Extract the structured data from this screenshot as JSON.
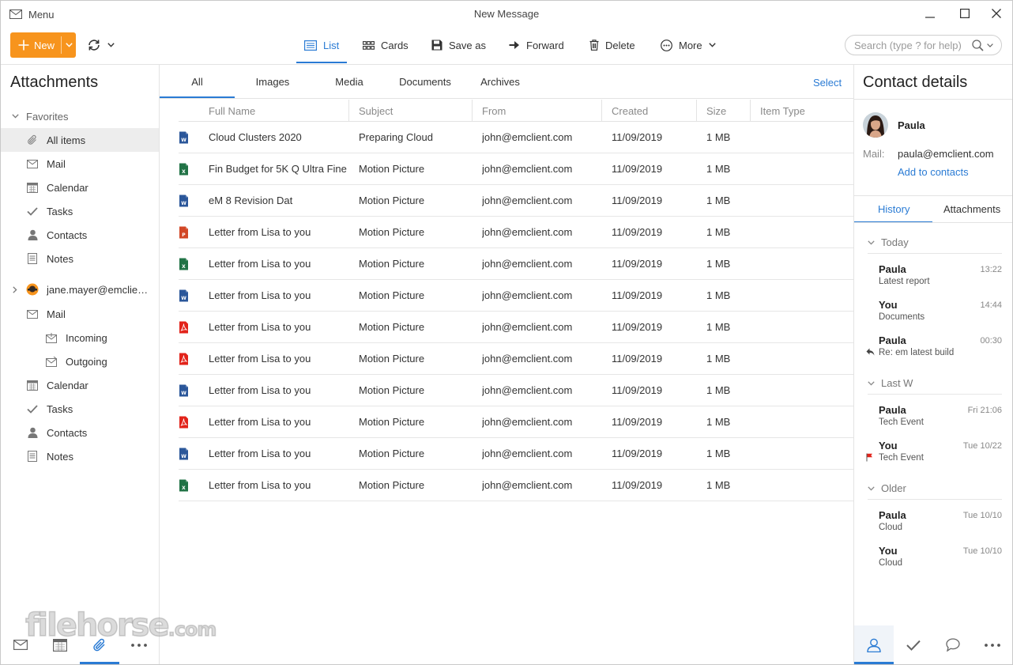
{
  "window": {
    "menu_label": "Menu",
    "title": "New Message"
  },
  "toolbar": {
    "new_label": "New",
    "items": [
      {
        "label": "List",
        "icon": "list-icon",
        "active": true
      },
      {
        "label": "Cards",
        "icon": "cards-icon",
        "active": false
      },
      {
        "label": "Save as",
        "icon": "floppy-disk-icon",
        "active": false
      },
      {
        "label": "Forward",
        "icon": "arrow-right-icon",
        "active": false
      },
      {
        "label": "Delete",
        "icon": "trash-icon",
        "active": false
      },
      {
        "label": "More",
        "icon": "more-circle-icon",
        "active": false
      }
    ],
    "search_placeholder": "Search (type ? for help)"
  },
  "sidebar": {
    "title": "Attachments",
    "favorites_label": "Favorites",
    "favorites": [
      {
        "label": "All items",
        "icon": "paperclip-icon",
        "selected": true
      },
      {
        "label": "Mail",
        "icon": "envelope-icon"
      },
      {
        "label": "Calendar",
        "icon": "calendar-icon"
      },
      {
        "label": "Tasks",
        "icon": "checkmark-icon"
      },
      {
        "label": "Contacts",
        "icon": "person-icon"
      },
      {
        "label": "Notes",
        "icon": "note-icon"
      }
    ],
    "account_label": "jane.mayer@emclient.com",
    "account_items": [
      {
        "label": "Mail",
        "icon": "envelope-icon",
        "level": 1
      },
      {
        "label": "Incoming",
        "icon": "inbox-icon",
        "level": 2
      },
      {
        "label": "Outgoing",
        "icon": "outbox-icon",
        "level": 2
      },
      {
        "label": "Calendar",
        "icon": "calendar-icon",
        "level": 1
      },
      {
        "label": "Tasks",
        "icon": "checkmark-icon",
        "level": 1
      },
      {
        "label": "Contacts",
        "icon": "person-icon",
        "level": 1
      },
      {
        "label": "Notes",
        "icon": "note-icon",
        "level": 1
      }
    ]
  },
  "bottom_nav_left": [
    "envelope-icon",
    "calendar-icon",
    "paperclip-icon",
    "more-dots-icon"
  ],
  "watermark": {
    "main": "filehorse",
    "suffix": ".com"
  },
  "main": {
    "tabs": [
      "All",
      "Images",
      "Media",
      "Documents",
      "Archives"
    ],
    "active_tab": "All",
    "select_label": "Select",
    "columns": [
      "Full Name",
      "Subject",
      "From",
      "Created",
      "Size",
      "Item Type"
    ],
    "rows": [
      {
        "type": "word",
        "name": "Cloud Clusters 2020",
        "subject": "Preparing Cloud",
        "from": "john@emclient.com",
        "created": "11/09/2019",
        "size": "1 MB"
      },
      {
        "type": "excel",
        "name": "Fin Budget for 5K Q Ultra Fine",
        "subject": "Motion Picture",
        "from": "john@emclient.com",
        "created": "11/09/2019",
        "size": "1 MB"
      },
      {
        "type": "word",
        "name": "eM 8 Revision Dat",
        "subject": "Motion Picture",
        "from": "john@emclient.com",
        "created": "11/09/2019",
        "size": "1 MB"
      },
      {
        "type": "powerpoint",
        "name": "Letter from Lisa to you",
        "subject": "Motion Picture",
        "from": "john@emclient.com",
        "created": "11/09/2019",
        "size": "1 MB"
      },
      {
        "type": "excel",
        "name": "Letter from Lisa to you",
        "subject": "Motion Picture",
        "from": "john@emclient.com",
        "created": "11/09/2019",
        "size": "1 MB"
      },
      {
        "type": "word",
        "name": "Letter from Lisa to you",
        "subject": "Motion Picture",
        "from": "john@emclient.com",
        "created": "11/09/2019",
        "size": "1 MB"
      },
      {
        "type": "pdf",
        "name": "Letter from Lisa to you",
        "subject": "Motion Picture",
        "from": "john@emclient.com",
        "created": "11/09/2019",
        "size": "1 MB"
      },
      {
        "type": "pdf",
        "name": "Letter from Lisa to you",
        "subject": "Motion Picture",
        "from": "john@emclient.com",
        "created": "11/09/2019",
        "size": "1 MB"
      },
      {
        "type": "word",
        "name": "Letter from Lisa to you",
        "subject": "Motion Picture",
        "from": "john@emclient.com",
        "created": "11/09/2019",
        "size": "1 MB"
      },
      {
        "type": "pdf",
        "name": "Letter from Lisa to you",
        "subject": "Motion Picture",
        "from": "john@emclient.com",
        "created": "11/09/2019",
        "size": "1 MB"
      },
      {
        "type": "word",
        "name": "Letter from Lisa to you",
        "subject": "Motion Picture",
        "from": "john@emclient.com",
        "created": "11/09/2019",
        "size": "1 MB"
      },
      {
        "type": "excel",
        "name": "Letter from Lisa to you",
        "subject": "Motion Picture",
        "from": "john@emclient.com",
        "created": "11/09/2019",
        "size": "1 MB"
      }
    ]
  },
  "contact": {
    "title": "Contact details",
    "name": "Paula",
    "mail_label": "Mail:",
    "mail": "paula@emclient.com",
    "add_label": "Add to contacts",
    "tabs": [
      "History",
      "Attachments"
    ],
    "history": [
      {
        "group": "Today",
        "items": [
          {
            "name": "Paula",
            "subject": "Latest report",
            "time": "13:22",
            "mark": ""
          },
          {
            "name": "You",
            "subject": "Documents",
            "time": "14:44",
            "mark": ""
          },
          {
            "name": "Paula",
            "subject": "Re: em latest build",
            "time": "00:30",
            "mark": "reply"
          }
        ]
      },
      {
        "group": "Last W",
        "items": [
          {
            "name": "Paula",
            "subject": "Tech Event",
            "time": "Fri 21:06",
            "mark": ""
          },
          {
            "name": "You",
            "subject": "Tech Event",
            "time": "Tue 10/22",
            "mark": "flag"
          }
        ]
      },
      {
        "group": "Older",
        "items": [
          {
            "name": "Paula",
            "subject": "Cloud",
            "time": "Tue 10/10",
            "mark": ""
          },
          {
            "name": "You",
            "subject": "Cloud",
            "time": "Tue 10/10",
            "mark": ""
          }
        ]
      }
    ]
  },
  "bottom_nav_right": [
    "person-icon",
    "checkmark-icon",
    "chat-bubble-icon",
    "more-dots-icon"
  ],
  "colors": {
    "accent": "#2a7bd4",
    "new_button": "#f7941d",
    "word": "#2b579a",
    "excel": "#217346",
    "powerpoint": "#d24726",
    "pdf": "#e2231a"
  }
}
